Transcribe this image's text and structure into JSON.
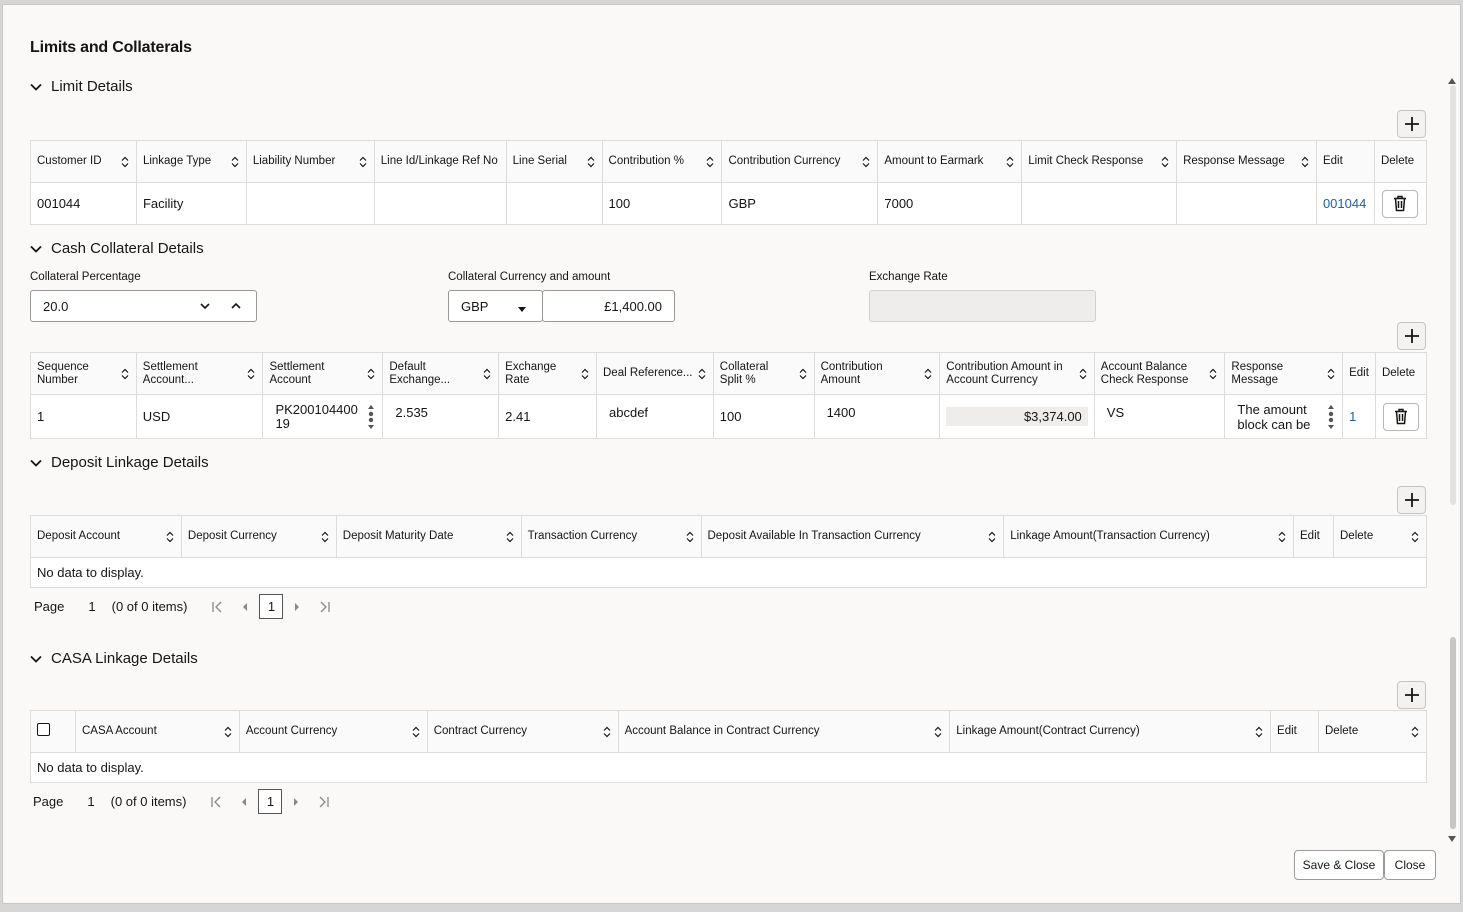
{
  "title": "Limits and Collaterals",
  "limit": {
    "heading": "Limit Details",
    "columns": [
      "Customer ID",
      "Linkage Type",
      "Liability Number",
      "Line Id/Linkage Ref No",
      "Line Serial",
      "Contribution %",
      "Contribution Currency",
      "Amount to Earmark",
      "Limit Check Response",
      "Response Message",
      "Edit",
      "Delete"
    ],
    "rows": [
      {
        "customer_id": "001044",
        "linkage_type": "Facility",
        "liability_number": "",
        "line_id": "",
        "line_serial": "",
        "contribution_pct": "100",
        "contribution_currency": "GBP",
        "amount": "7000",
        "limit_check": "",
        "response": "",
        "edit": "001044"
      }
    ]
  },
  "cash": {
    "heading": "Cash Collateral Details",
    "pct_label": "Collateral Percentage",
    "pct_value": "20.0",
    "ccy_label": "Collateral Currency and amount",
    "ccy_value": "GBP",
    "amount_value": "£1,400.00",
    "rate_label": "Exchange Rate",
    "rate_value": "",
    "columns": [
      "Sequence Number",
      "Settlement Account...",
      "Settlement Account",
      "Default Exchange...",
      "Exchange Rate",
      "Deal Reference...",
      "Collateral Split %",
      "Contribution Amount",
      "Contribution Amount in Account Currency",
      "Account Balance Check Response",
      "Response Message",
      "Edit",
      "Delete"
    ],
    "rows": [
      {
        "seq": "1",
        "settle_ccy": "USD",
        "settle_acct_1": "PK200104400",
        "settle_acct_2": "19",
        "default_rate": "2.535",
        "rate": "2.41",
        "deal_ref": "abcdef",
        "split": "100",
        "contrib": "1400",
        "contrib_acct": "$3,374.00",
        "bal_check": "VS",
        "resp_1": "The amount",
        "resp_2": "block can be",
        "edit": "1"
      }
    ]
  },
  "deposit": {
    "heading": "Deposit Linkage Details",
    "columns": [
      "Deposit Account",
      "Deposit Currency",
      "Deposit Maturity Date",
      "Transaction Currency",
      "Deposit Available In Transaction Currency",
      "Linkage Amount(Transaction Currency)",
      "Edit",
      "Delete"
    ],
    "empty": "No data to display.",
    "page_label": "Page",
    "page_value": "1",
    "items": "(0 of 0 items)",
    "current_page": "1"
  },
  "casa": {
    "heading": "CASA Linkage Details",
    "columns": [
      "CASA Account",
      "Account Currency",
      "Contract Currency",
      "Account Balance in Contract Currency",
      "Linkage Amount(Contract Currency)",
      "Edit",
      "Delete"
    ],
    "empty": "No data to display.",
    "page_label": "Page",
    "page_value": "1",
    "items": "(0 of 0 items)",
    "current_page": "1"
  },
  "footer": {
    "save_close": "Save & Close",
    "close": "Close"
  },
  "colors": {
    "link": "#1f5f9e",
    "background": "#fbf9f8",
    "border": "#dedcda"
  }
}
